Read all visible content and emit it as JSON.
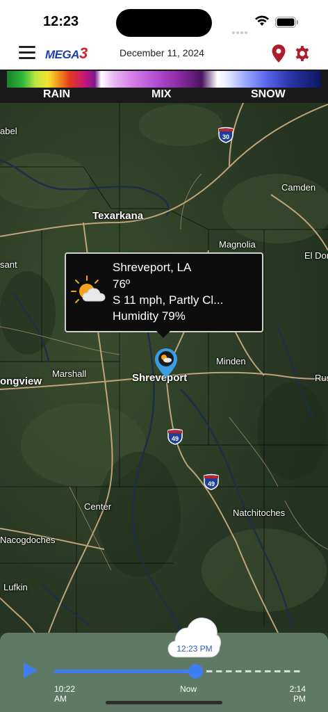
{
  "status_bar": {
    "time": "12:23"
  },
  "header": {
    "logo_text": "MEGA",
    "logo_number": "3",
    "date": "December 11, 2024",
    "icons": [
      "menu-icon",
      "location-pin-icon",
      "gear-icon"
    ]
  },
  "legend": {
    "labels": {
      "rain": "RAIN",
      "mix": "MIX",
      "snow": "SNOW"
    }
  },
  "map": {
    "cities": {
      "abel": "abel",
      "camden": "Camden",
      "texarkana": "Texarkana",
      "magnolia": "Magnolia",
      "el_dorado": "El Dor",
      "sant": "sant",
      "minden": "Minden",
      "rus": "Rus",
      "marshall": "Marshall",
      "longview": "ongview",
      "shreveport": "Shreveport",
      "center": "Center",
      "natchitoches": "Natchitoches",
      "nacogdoches": "Nacogdoches",
      "lufkin": "Lufkin"
    },
    "shields": {
      "i30": "30",
      "i49_a": "49",
      "i49_b": "49"
    }
  },
  "popup": {
    "location": "Shreveport, LA",
    "temperature": "76º",
    "wind_condition": "S 11 mph,  Partly Cl...",
    "humidity": "Humidity 79%",
    "icon": "partly-cloudy-icon"
  },
  "timeline": {
    "start_time": "10:22",
    "start_ampm": "AM",
    "now_label": "Now",
    "end_time": "2:14",
    "end_ampm": "PM",
    "current_time": "12:23 PM",
    "progress": 0.57
  },
  "colors": {
    "brand_blue": "#1e3fae",
    "brand_red": "#d0242b",
    "header_icon_red": "#a91f2a",
    "timeline_blue": "#3f7df2",
    "marker_blue": "#3a9ee6"
  }
}
